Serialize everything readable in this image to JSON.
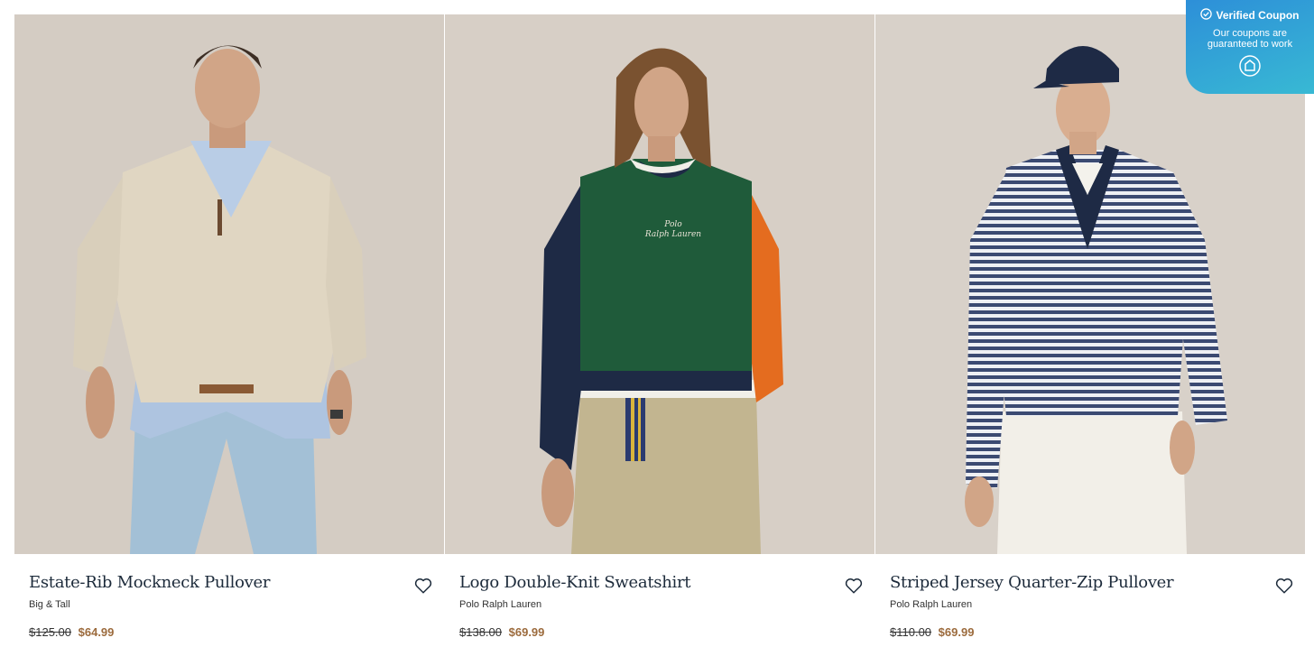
{
  "products": [
    {
      "title": "Estate-Rib Mockneck Pullover",
      "brand": "Big & Tall",
      "old_price": "$125.00",
      "price": "$64.99",
      "image": "man-tan-quarter-zip-jeans"
    },
    {
      "title": "Logo Double-Knit Sweatshirt",
      "brand": "Polo Ralph Lauren",
      "old_price": "$138.00",
      "price": "$69.99",
      "image": "man-green-colorblock-sweatshirt"
    },
    {
      "title": "Striped Jersey Quarter-Zip Pullover",
      "brand": "Polo Ralph Lauren",
      "old_price": "$110.00",
      "price": "$69.99",
      "image": "man-striped-quarter-zip-cap"
    }
  ],
  "sweatshirt_logo": [
    "Polo",
    "Ralph Lauren"
  ],
  "coupon": {
    "title": "Verified Coupon",
    "subtitle_line1": "Our coupons are",
    "subtitle_line2": "guaranteed to work"
  },
  "colors": {
    "title": "#1c2a3a",
    "sale_price": "#9c6b3d",
    "coupon_bg": "#2d8fd8",
    "backdrop": "#d8d0c7"
  },
  "icons": {
    "wishlist": "heart-outline-icon",
    "verified": "check-circle-icon",
    "coupon_logo": "tag-logo-icon"
  }
}
